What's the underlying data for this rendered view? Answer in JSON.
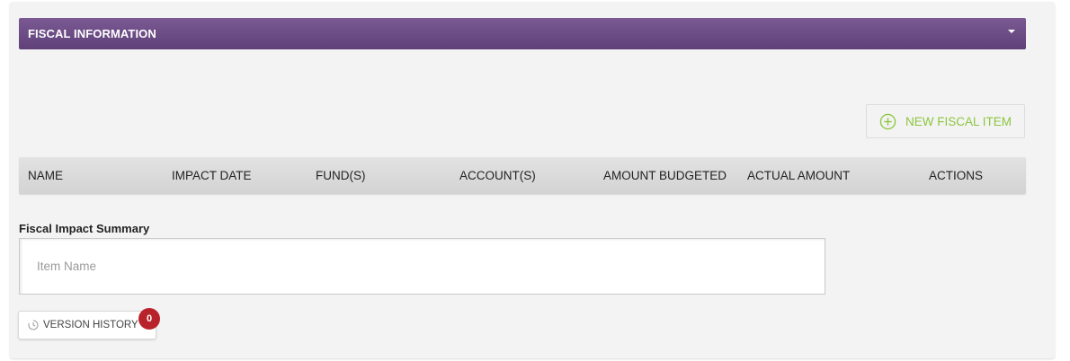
{
  "section": {
    "title": "FISCAL INFORMATION",
    "toggle_icon": "caret-down-icon"
  },
  "toolbar": {
    "new_item_label": "NEW FISCAL ITEM",
    "new_item_icon": "plus-circle-icon",
    "accent_color": "#8cc63f"
  },
  "table": {
    "columns": [
      "NAME",
      "IMPACT DATE",
      "FUND(S)",
      "ACCOUNT(S)",
      "AMOUNT BUDGETED",
      "ACTUAL AMOUNT",
      "ACTIONS"
    ],
    "rows": []
  },
  "summary": {
    "label": "Fiscal Impact Summary",
    "value": "",
    "placeholder": "Item Name"
  },
  "version_history": {
    "label": "VERSION HISTORY",
    "icon": "clock-icon",
    "count": "0",
    "badge_color": "#b8232b"
  },
  "theme": {
    "header_color": "#6d4c86"
  }
}
